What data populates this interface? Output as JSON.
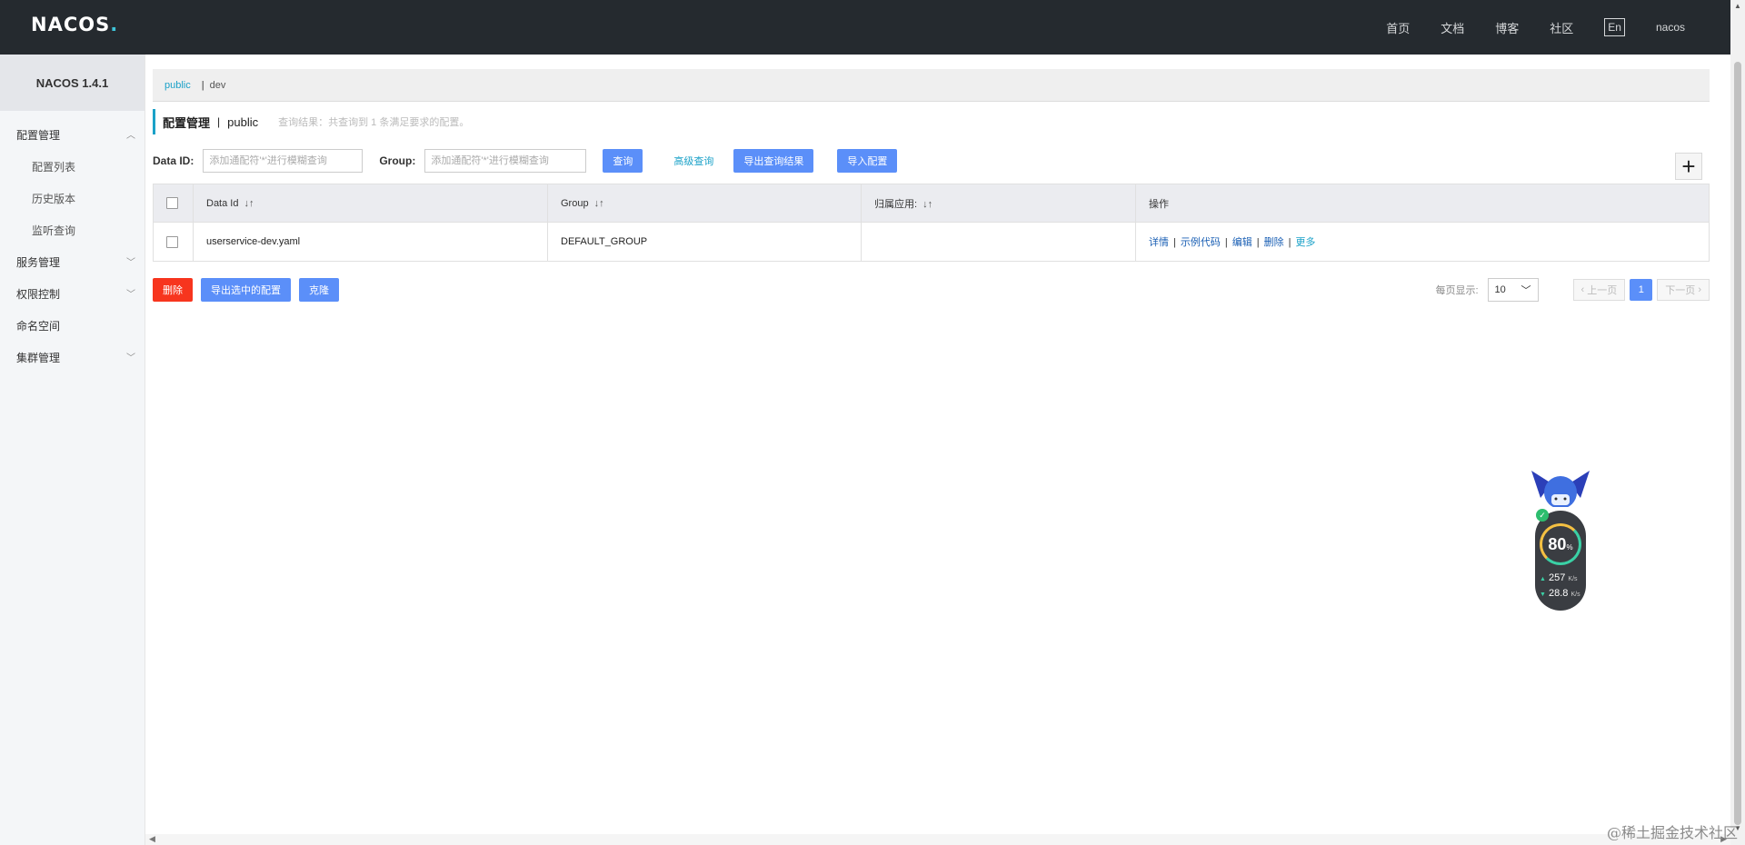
{
  "header": {
    "logo": "NACOS",
    "nav": [
      "首页",
      "文档",
      "博客",
      "社区"
    ],
    "lang": "En",
    "user": "nacos"
  },
  "sidebar": {
    "brand": "NACOS 1.4.1",
    "items": [
      {
        "label": "配置管理",
        "expanded": true
      },
      {
        "label": "配置列表"
      },
      {
        "label": "历史版本"
      },
      {
        "label": "监听查询"
      },
      {
        "label": "服务管理"
      },
      {
        "label": "权限控制"
      },
      {
        "label": "命名空间"
      },
      {
        "label": "集群管理"
      }
    ]
  },
  "namespace": {
    "active": "public",
    "other": "dev"
  },
  "title": {
    "main": "配置管理",
    "namespace": "public",
    "hint": "查询结果：共查询到 1 条满足要求的配置。"
  },
  "search": {
    "dataid_label": "Data ID:",
    "dataid_placeholder": "添加通配符'*'进行模糊查询",
    "group_label": "Group:",
    "group_placeholder": "添加通配符'*'进行模糊查询",
    "query_btn": "查询",
    "advanced_link": "高级查询",
    "export_btn": "导出查询结果",
    "import_btn": "导入配置",
    "add_icon": "plus-icon"
  },
  "table": {
    "headers": [
      "Data Id",
      "Group",
      "归属应用:",
      "操作"
    ],
    "rows": [
      {
        "data_id": "userservice-dev.yaml",
        "group": "DEFAULT_GROUP",
        "app": "",
        "ops": [
          "详情",
          "示例代码",
          "编辑",
          "删除",
          "更多"
        ]
      }
    ]
  },
  "actions": {
    "delete_btn": "删除",
    "export_selected_btn": "导出选中的配置",
    "clone_btn": "克隆"
  },
  "pagination": {
    "page_size_label": "每页显示:",
    "page_size": "10",
    "prev": "上一页",
    "current": "1",
    "next": "下一页"
  },
  "widget": {
    "percent": "80",
    "percent_unit": "%",
    "up_speed": "257",
    "down_speed": "28.8",
    "speed_unit": "K/s"
  },
  "watermark": "@稀土掘金技术社区",
  "colors": {
    "header_bg": "#252a2f",
    "accent": "#1aa1c8",
    "primary_btn": "#5b8ff9",
    "danger_btn": "#f7351e"
  }
}
